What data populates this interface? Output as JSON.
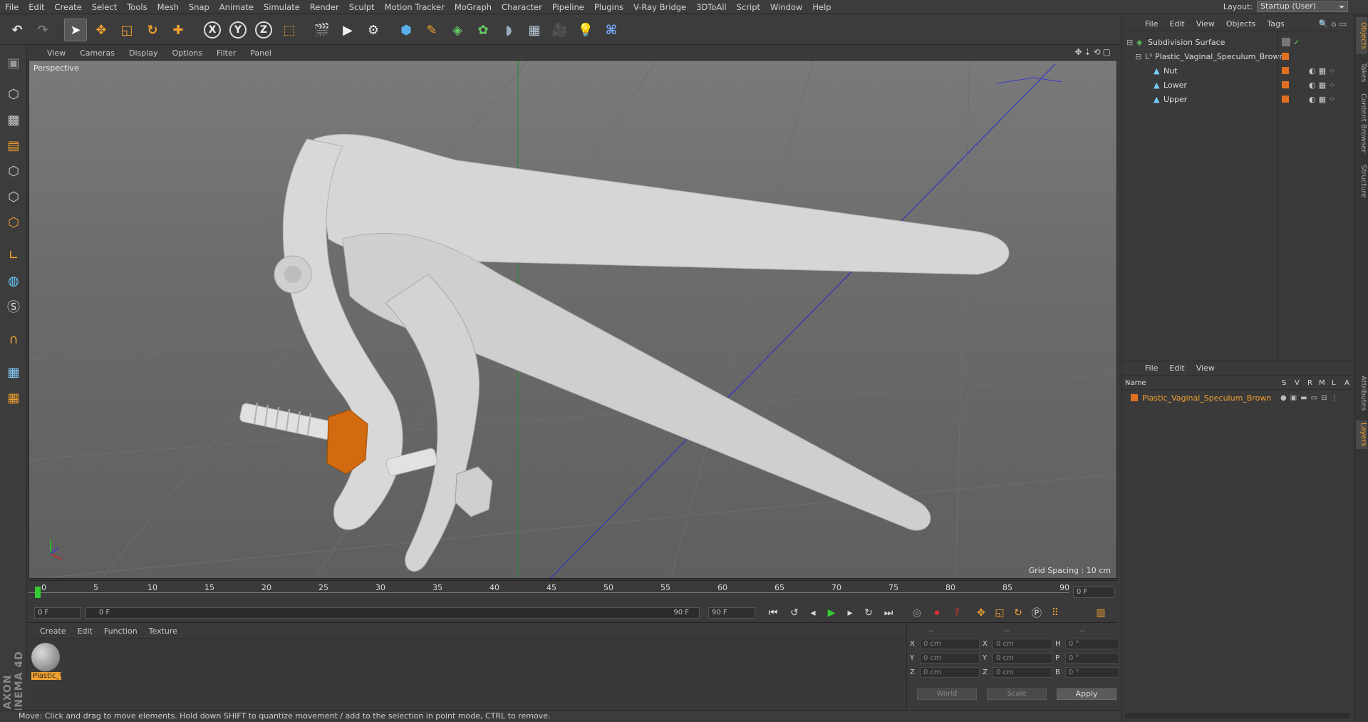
{
  "menubar": {
    "items": [
      "File",
      "Edit",
      "Create",
      "Select",
      "Tools",
      "Mesh",
      "Snap",
      "Animate",
      "Simulate",
      "Render",
      "Sculpt",
      "Motion Tracker",
      "MoGraph",
      "Character",
      "Pipeline",
      "Plugins",
      "V-Ray Bridge",
      "3DToAll",
      "Script",
      "Window",
      "Help"
    ],
    "layout_label": "Layout:",
    "layout_value": "Startup (User)"
  },
  "toolbar": {
    "icons": [
      "undo-icon",
      "redo-icon",
      "select-arrow-icon",
      "move-icon",
      "scale-icon",
      "rotate-icon",
      "create-icon",
      "x-axis-icon",
      "y-axis-icon",
      "z-axis-icon",
      "coordinate-system-icon",
      "render-view-icon",
      "render-picture-viewer-icon",
      "edit-render-settings-icon",
      "cube-icon",
      "pen-spline-icon",
      "subdivision-nurbs-icon",
      "array-mograph-icon",
      "deformer-icon",
      "floor-environment-icon",
      "camera-icon",
      "light-icon",
      "python-icon"
    ],
    "axis_x": "X",
    "axis_y": "Y",
    "axis_z": "Z"
  },
  "viewport": {
    "menu": [
      "View",
      "Cameras",
      "Display",
      "Options",
      "Filter",
      "Panel"
    ],
    "label": "Perspective",
    "grid_spacing": "Grid Spacing : 10 cm"
  },
  "timeline": {
    "ticks": [
      "0",
      "5",
      "10",
      "15",
      "20",
      "25",
      "30",
      "35",
      "40",
      "45",
      "50",
      "55",
      "60",
      "65",
      "70",
      "75",
      "80",
      "85",
      "90"
    ],
    "current_frame_field": "0 F",
    "start_field": "0 F",
    "range_start": "0 F",
    "range_end": "90 F",
    "end_field": "90 F"
  },
  "material_manager": {
    "menu": [
      "Create",
      "Edit",
      "Function",
      "Texture"
    ],
    "material_name": "Plastic_V"
  },
  "coordinates": {
    "header_dashes": [
      "--",
      "--",
      "--"
    ],
    "rows": [
      {
        "l1": "X",
        "v1": "0 cm",
        "l2": "X",
        "v2": "0 cm",
        "l3": "H",
        "v3": "0 °"
      },
      {
        "l1": "Y",
        "v1": "0 cm",
        "l2": "Y",
        "v2": "0 cm",
        "l3": "P",
        "v3": "0 °"
      },
      {
        "l1": "Z",
        "v1": "0 cm",
        "l2": "Z",
        "v2": "0 cm",
        "l3": "B",
        "v3": "0 °"
      }
    ],
    "mode_world": "World",
    "mode_scale": "Scale",
    "apply": "Apply"
  },
  "status": "Move: Click and drag to move elements. Hold down SHIFT to quantize movement / add to the selection in point mode, CTRL to remove.",
  "objects_panel": {
    "menu": [
      "File",
      "Edit",
      "View",
      "Objects",
      "Tags"
    ],
    "items": [
      {
        "name": "Subdivision Surface",
        "indent": 0,
        "icon": "subdivision-surface-icon"
      },
      {
        "name": "Plastic_Vaginal_Speculum_Brown",
        "indent": 1,
        "icon": "null-object-icon"
      },
      {
        "name": "Nut",
        "indent": 2,
        "icon": "polygon-object-icon"
      },
      {
        "name": "Lower",
        "indent": 2,
        "icon": "polygon-object-icon"
      },
      {
        "name": "Upper",
        "indent": 2,
        "icon": "polygon-object-icon"
      }
    ]
  },
  "layers_panel": {
    "menu": [
      "File",
      "Edit",
      "View"
    ],
    "columns": [
      "Name",
      "S",
      "V",
      "R",
      "M",
      "L",
      "A"
    ],
    "layer_name": "Plastic_Vaginal_Speculum_Brown"
  },
  "side_tabs": [
    "Objects",
    "Takes",
    "Content Browser",
    "Structure",
    "Attributes",
    "Layers"
  ],
  "colors": {
    "accent": "#f0a030",
    "layer_orange": "#e07020",
    "nut_orange": "#d26a10"
  }
}
